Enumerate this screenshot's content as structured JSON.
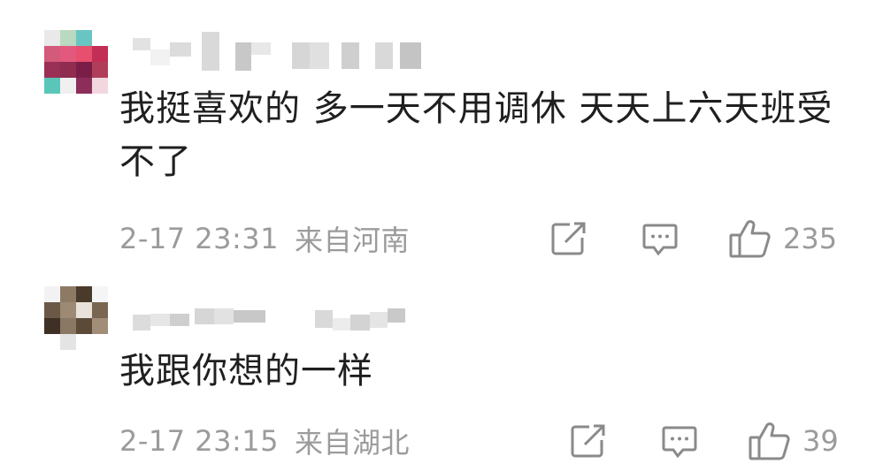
{
  "comments": [
    {
      "username_redacted": true,
      "text": "我挺喜欢的 多一天不用调休 天天上六天班受不了",
      "time": "2-17 23:31",
      "location": "来自河南",
      "likes": "235",
      "icons": {
        "share": "share-icon",
        "reply": "comment-icon",
        "like": "thumbs-up-icon"
      }
    },
    {
      "username_redacted": true,
      "text": "我跟你想的一样",
      "time": "2-17 23:15",
      "location": "来自湖北",
      "likes": "39",
      "icons": {
        "share": "share-icon",
        "reply": "comment-icon",
        "like": "thumbs-up-icon"
      }
    }
  ],
  "colors": {
    "meta_text": "#9b9b9b",
    "body_text": "#1f1f1f",
    "icon": "#8a8a8a"
  }
}
